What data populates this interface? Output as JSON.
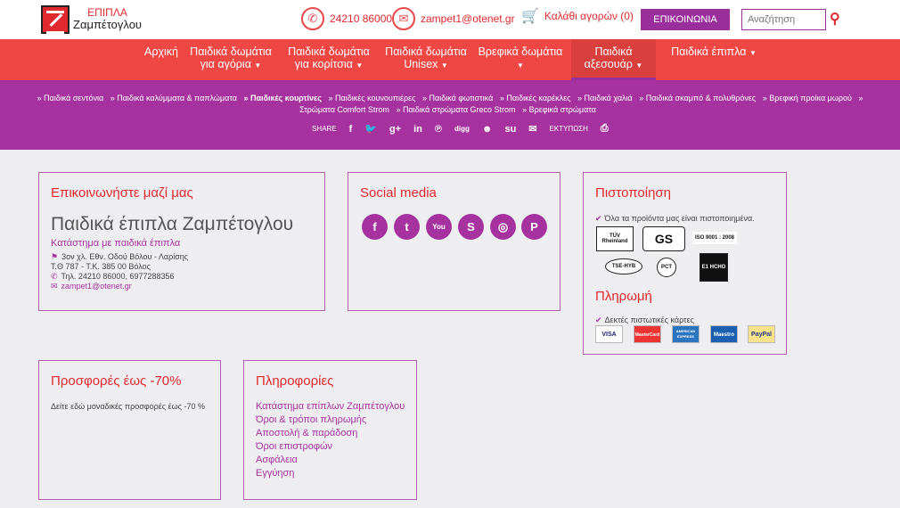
{
  "brand": {
    "line1": "ΕΠΙΠΛΑ",
    "line2": "Ζαμπέτογλου"
  },
  "header": {
    "phone": "24210 86000",
    "email": "zampet1@otenet.gr",
    "cart": "Καλάθι αγορών (0)",
    "contact_btn": "ΕΠΙΚΟΙΝΩΝΙΑ",
    "search_placeholder": "Αναζήτηση"
  },
  "nav": [
    {
      "l1": "",
      "l2": "Αρχική"
    },
    {
      "l1": "Παιδικά δωμάτια",
      "l2": "για αγόρια"
    },
    {
      "l1": "Παιδικά δωμάτια",
      "l2": "για κορίτσια"
    },
    {
      "l1": "Παιδικά δωμάτια",
      "l2": "Unisex"
    },
    {
      "l1": "Βρεφικά δωμάτια",
      "l2": ""
    },
    {
      "l1": "Παιδικά",
      "l2": "αξεσουάρ"
    },
    {
      "l1": "",
      "l2": "Παιδικά έπιπλα"
    }
  ],
  "subcats": [
    "» Παιδικά σεντόνια",
    "» Παιδικά καλύμματα & παπλώματα",
    "» Παιδικές κουρτίνες",
    "» Παιδικές κουνουπιέρες",
    "» Παιδικά φωτιστικά",
    "» Παιδικές καρέκλες",
    "» Παιδικά χαλιά",
    "» Παιδικά σκαμπό & πολυθρόνες",
    "» Βρεφική προίκα μωρού",
    "» Στρώματα Comfort Strom",
    "» Παιδικά στρώματα Greco Strom",
    "» Βρεφικά στρώματα"
  ],
  "share": {
    "label": "SHARE",
    "print": "ΕΚΤΥΠΩΣΗ"
  },
  "contact": {
    "title": "Επικοινωνήστε μαζί μας",
    "name": "Παιδικά έπιπλα Ζαμπέτογλου",
    "sub": "Κατάστημα με παιδικά έπιπλα",
    "addr1": "3ον χλ. Εθν. Οδού Βόλου - Λαρίσης",
    "addr2": "Τ.Θ 787 - Τ.Κ. 385 00 Βόλος",
    "tel": "Τηλ. 24210 86000, 6977288356",
    "email": "zampet1@otenet.gr"
  },
  "social": {
    "title": "Social media"
  },
  "cert": {
    "title": "Πιστοποίηση",
    "text": "Όλα τα προϊόντα μας είναι πιστοποιημένα.",
    "labels": [
      "TÜV Rheinland",
      "GS",
      "ISO 9001 : 2008",
      "TSE-HYB",
      "PCT",
      "E1 HCHO"
    ]
  },
  "payment": {
    "title": "Πληρωμή",
    "text": "Δεκτές πιστωτικές κάρτες",
    "cards": [
      "VISA",
      "MasterCard",
      "AMERICAN EXPRESS",
      "Maestro",
      "PayPal"
    ]
  },
  "offers": {
    "title": "Προσφορές έως -70%",
    "text": "Δείτε εδώ μοναδικές προσφορές έως -70 %"
  },
  "info": {
    "title": "Πληροφορίες",
    "links": [
      "Κατάστημα επίπλων Ζαμπέτογλου",
      "Όροι & τρόποι πληρωμής",
      "Αποστολή & παράδοση",
      "Όροι επιστροφών",
      "Ασφάλεια",
      "Εγγύηση"
    ]
  }
}
